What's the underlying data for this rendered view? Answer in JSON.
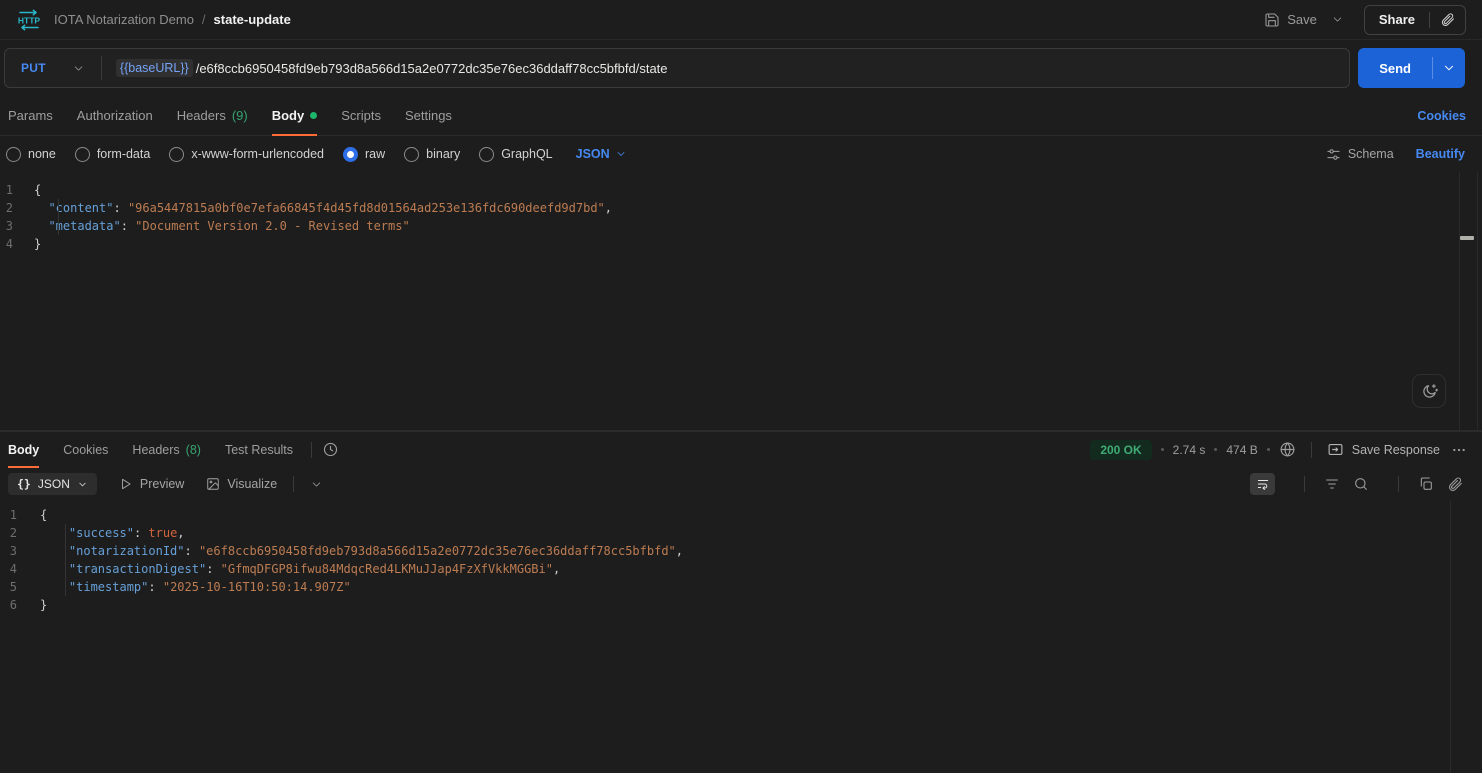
{
  "topbar": {
    "breadcrumb_collection": "IOTA Notarization Demo",
    "breadcrumb_separator": "/",
    "breadcrumb_request": "state-update",
    "save_label": "Save",
    "share_label": "Share"
  },
  "request": {
    "method": "PUT",
    "url_variable": "{{baseURL}}",
    "url_path": "/e6f8ccb6950458fd9eb793d8a566d15a2e0772dc35e76ec36ddaff78cc5bfbfd/state",
    "send_label": "Send",
    "tabs": [
      {
        "label": "Params"
      },
      {
        "label": "Authorization"
      },
      {
        "label": "Headers",
        "count": "(9)"
      },
      {
        "label": "Body"
      },
      {
        "label": "Scripts"
      },
      {
        "label": "Settings"
      }
    ],
    "cookies_link": "Cookies",
    "body_types": [
      "none",
      "form-data",
      "x-www-form-urlencoded",
      "raw",
      "binary",
      "GraphQL"
    ],
    "selected_body_type": "raw",
    "language": "JSON",
    "schema_label": "Schema",
    "beautify_label": "Beautify",
    "body_code": [
      [
        {
          "c": "p",
          "v": "{"
        }
      ],
      [
        {
          "c": "p",
          "v": "  "
        },
        {
          "c": "k",
          "v": "\"content\""
        },
        {
          "c": "p",
          "v": ": "
        },
        {
          "c": "s",
          "v": "\"96a5447815a0bf0e7efa66845f4d45fd8d01564ad253e136fdc690deefd9d7bd\""
        },
        {
          "c": "p",
          "v": ","
        }
      ],
      [
        {
          "c": "p",
          "v": "  "
        },
        {
          "c": "k",
          "v": "\"metadata\""
        },
        {
          "c": "p",
          "v": ": "
        },
        {
          "c": "s",
          "v": "\"Document Version 2.0 - Revised terms\""
        }
      ],
      [
        {
          "c": "p",
          "v": "}"
        }
      ]
    ]
  },
  "response": {
    "tabs": [
      {
        "label": "Body"
      },
      {
        "label": "Cookies"
      },
      {
        "label": "Headers",
        "count": "(8)"
      },
      {
        "label": "Test Results"
      }
    ],
    "status": "200 OK",
    "time": "2.74 s",
    "size": "474 B",
    "save_response_label": "Save Response",
    "format_braces": "{}",
    "format_label": "JSON",
    "preview_label": "Preview",
    "visualize_label": "Visualize",
    "body_code": [
      [
        {
          "c": "p",
          "v": "{"
        }
      ],
      [
        {
          "c": "p",
          "v": "    "
        },
        {
          "c": "k",
          "v": "\"success\""
        },
        {
          "c": "p",
          "v": ": "
        },
        {
          "c": "b",
          "v": "true"
        },
        {
          "c": "p",
          "v": ","
        }
      ],
      [
        {
          "c": "p",
          "v": "    "
        },
        {
          "c": "k",
          "v": "\"notarizationId\""
        },
        {
          "c": "p",
          "v": ": "
        },
        {
          "c": "s",
          "v": "\"e6f8ccb6950458fd9eb793d8a566d15a2e0772dc35e76ec36ddaff78cc5bfbfd\""
        },
        {
          "c": "p",
          "v": ","
        }
      ],
      [
        {
          "c": "p",
          "v": "    "
        },
        {
          "c": "k",
          "v": "\"transactionDigest\""
        },
        {
          "c": "p",
          "v": ": "
        },
        {
          "c": "s",
          "v": "\"GfmqDFGP8ifwu84MdqcRed4LKMuJJap4FzXfVkkMGGBi\""
        },
        {
          "c": "p",
          "v": ","
        }
      ],
      [
        {
          "c": "p",
          "v": "    "
        },
        {
          "c": "k",
          "v": "\"timestamp\""
        },
        {
          "c": "p",
          "v": ": "
        },
        {
          "c": "s",
          "v": "\"2025-10-16T10:50:14.907Z\""
        }
      ],
      [
        {
          "c": "p",
          "v": "}"
        }
      ]
    ]
  },
  "colors": {
    "accent_orange": "#ff6c37",
    "link_blue": "#4689f2",
    "send_blue": "#1c63d8",
    "success_green": "#3fab75"
  }
}
